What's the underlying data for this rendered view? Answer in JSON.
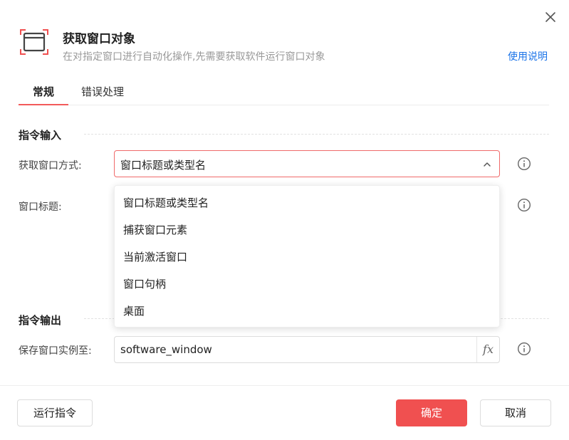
{
  "header": {
    "title": "获取窗口对象",
    "subtitle": "在对指定窗口进行自动化操作,先需要获取软件运行窗口对象",
    "help_link": "使用说明",
    "icon": "window-capture-icon"
  },
  "tabs": [
    {
      "label": "常规",
      "active": true
    },
    {
      "label": "错误处理",
      "active": false
    }
  ],
  "input_section": {
    "title": "指令输入",
    "fields": [
      {
        "label": "获取窗口方式:",
        "value": "窗口标题或类型名"
      },
      {
        "label": "窗口标题:"
      }
    ]
  },
  "dropdown": {
    "options": [
      "窗口标题或类型名",
      "捕获窗口元素",
      "当前激活窗口",
      "窗口句柄",
      "桌面"
    ]
  },
  "output_section": {
    "title": "指令输出",
    "fields": [
      {
        "label": "保存窗口实例至:",
        "value": "software_window",
        "fx": "fx"
      }
    ]
  },
  "footer": {
    "run_label": "运行指令",
    "ok_label": "确定",
    "cancel_label": "取消"
  },
  "colors": {
    "accent": "#f05050",
    "link": "#1a73e8"
  }
}
